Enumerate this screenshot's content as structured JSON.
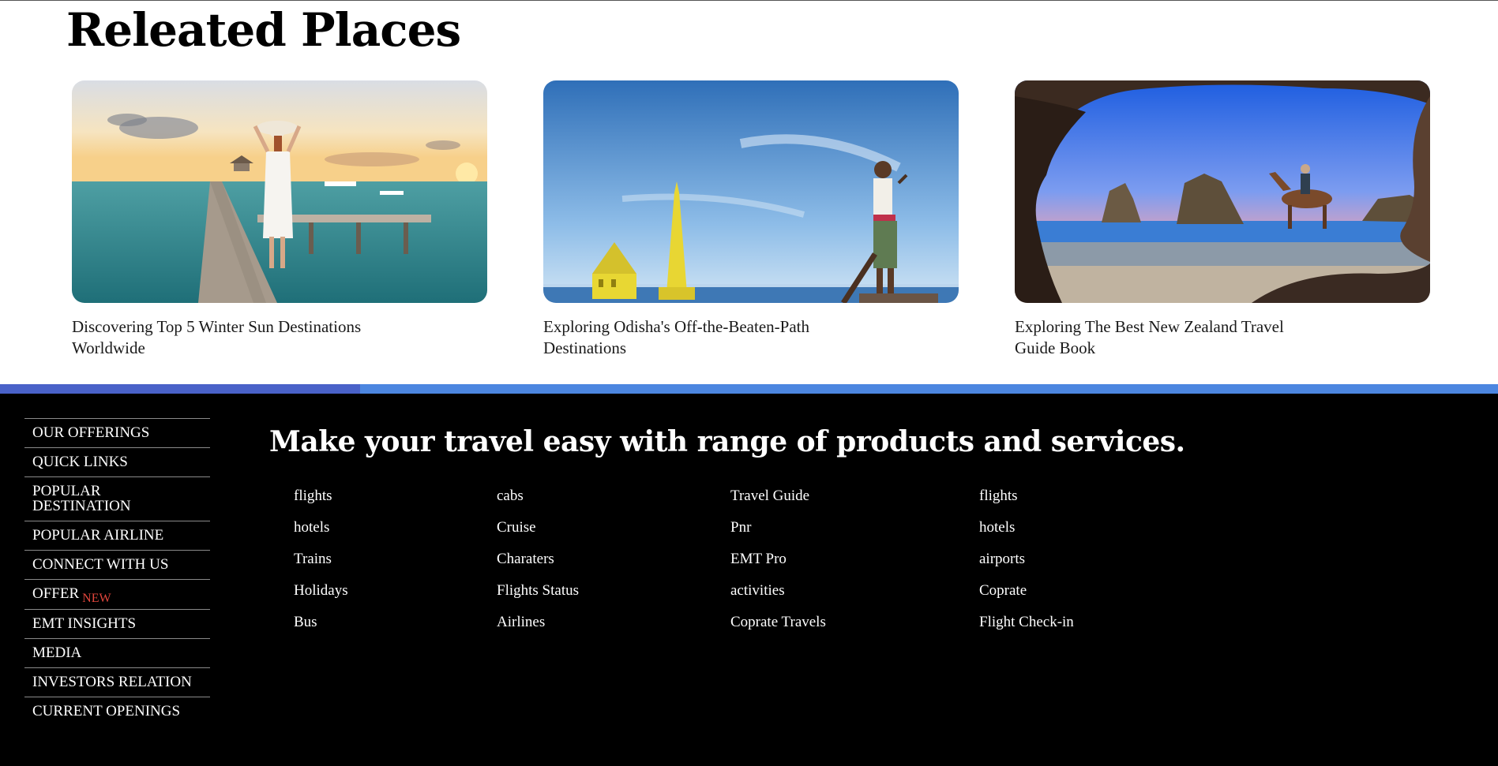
{
  "related": {
    "title": "Releated Places",
    "cards": [
      {
        "caption": "Discovering Top 5 Winter Sun Destinations Worldwide"
      },
      {
        "caption": "Exploring Odisha's Off-the-Beaten-Path Destinations"
      },
      {
        "caption": "Exploring The Best New Zealand Travel Guide Book"
      }
    ]
  },
  "colors": {
    "accent_left": "#4a62c8",
    "accent_right": "#4c86e0",
    "footer_bg": "#000000",
    "badge_red": "#e2463c"
  },
  "footer": {
    "heading": "Make your travel easy with range of products and services.",
    "side_menu": [
      "OUR OFFERINGS",
      "QUICK LINKS",
      "POPULAR DESTINATION",
      "POPULAR AIRLINE",
      "CONNECT WITH US",
      "OFFER",
      "EMT INSIGHTS",
      "MEDIA",
      "INVESTORS RELATION",
      "CURRENT OPENINGS"
    ],
    "offer_badge": "NEW",
    "columns": [
      [
        "flights",
        "hotels",
        "Trains",
        "Holidays",
        "Bus"
      ],
      [
        "cabs",
        "Cruise",
        "Charaters",
        "Flights Status",
        "Airlines"
      ],
      [
        "Travel Guide",
        "Pnr",
        "EMT Pro",
        "activities",
        "Coprate Travels"
      ],
      [
        "flights",
        "hotels",
        "airports",
        "Coprate",
        "Flight Check-in"
      ]
    ]
  }
}
